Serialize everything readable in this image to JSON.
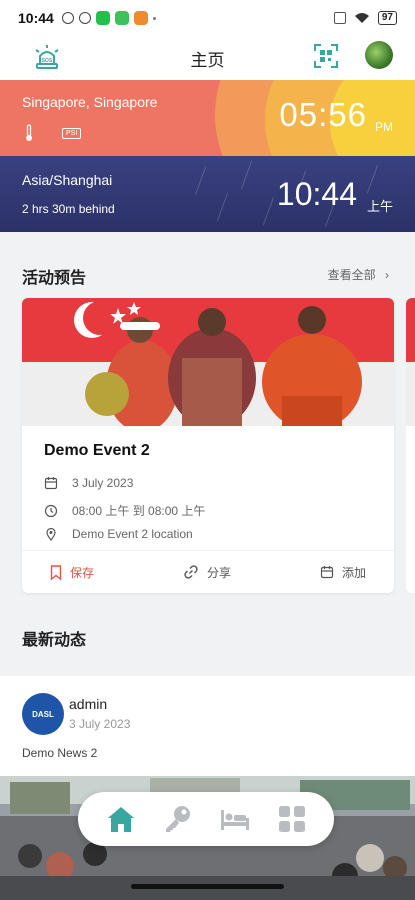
{
  "status_bar": {
    "time": "10:44",
    "battery": "97"
  },
  "header": {
    "title": "主页"
  },
  "clocks": {
    "local": {
      "city": "Singapore, Singapore",
      "psi_label": "PSI",
      "time": "05:56",
      "ampm": "PM"
    },
    "remote": {
      "city": "Asia/Shanghai",
      "diff": "2 hrs 30m behind",
      "time": "10:44",
      "ampm": "上午"
    }
  },
  "events": {
    "section_title": "活动预告",
    "see_all": "查看全部",
    "card": {
      "title": "Demo Event 2",
      "date": "3 July 2023",
      "time": "08:00 上午 到 08:00 上午",
      "location": "Demo Event 2 location",
      "actions": {
        "save": "保存",
        "share": "分享",
        "add": "添加"
      }
    }
  },
  "news": {
    "section_title": "最新动态",
    "item": {
      "avatar_text": "DASL",
      "author": "admin",
      "date": "3 July 2023",
      "body": "Demo News 2"
    }
  },
  "nav": {
    "items": [
      {
        "icon": "home-icon",
        "active": true
      },
      {
        "icon": "key-icon",
        "active": false
      },
      {
        "icon": "bed-icon",
        "active": false
      },
      {
        "icon": "grid-icon",
        "active": false
      }
    ]
  },
  "colors": {
    "accent": "#3aa6a0",
    "save": "#e05548",
    "sg_card": "#ee7464",
    "sh_card": "#2f3570"
  }
}
